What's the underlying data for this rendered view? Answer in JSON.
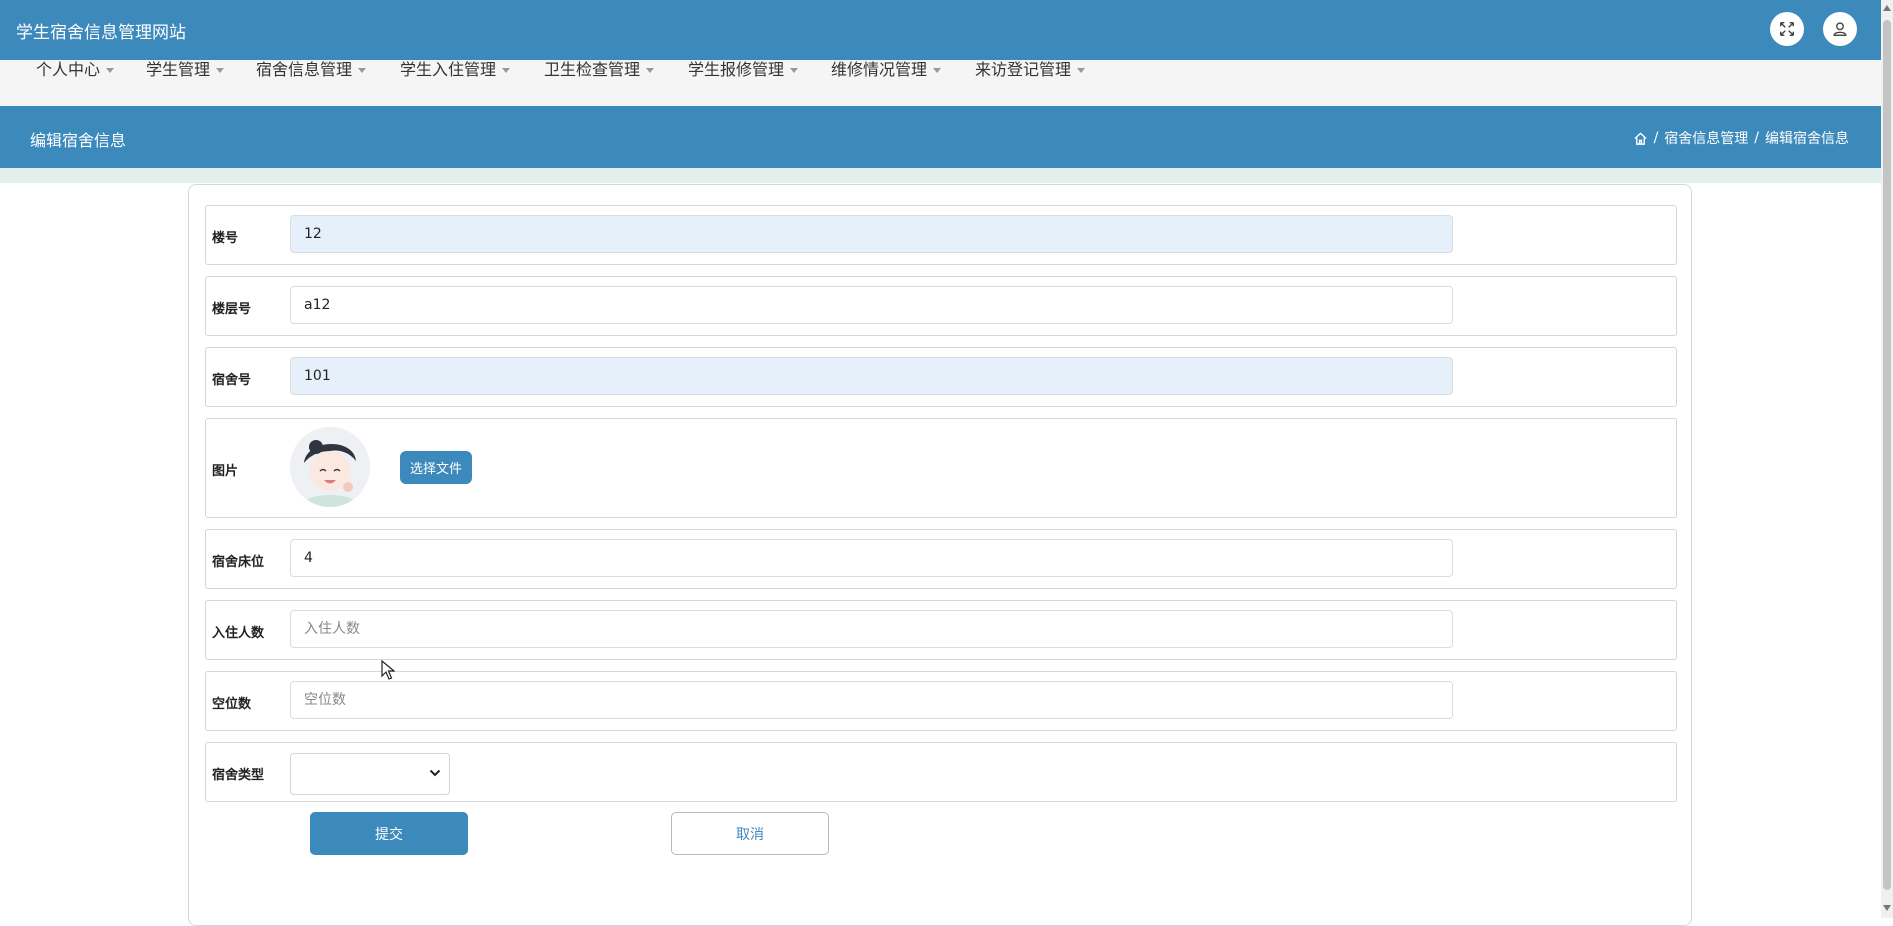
{
  "header": {
    "title": "学生宿舍信息管理网站"
  },
  "nav": {
    "items": [
      {
        "label": "个人中心"
      },
      {
        "label": "学生管理"
      },
      {
        "label": "宿舍信息管理"
      },
      {
        "label": "学生入住管理"
      },
      {
        "label": "卫生检查管理"
      },
      {
        "label": "学生报修管理"
      },
      {
        "label": "维修情况管理"
      },
      {
        "label": "来访登记管理"
      }
    ]
  },
  "page": {
    "title": "编辑宿舍信息",
    "breadcrumb": {
      "separator": "/",
      "section": "宿舍信息管理",
      "current": "编辑宿舍信息"
    }
  },
  "form": {
    "building": {
      "label": "楼号",
      "value": "12"
    },
    "floor": {
      "label": "楼层号",
      "value": "a12"
    },
    "dorm_no": {
      "label": "宿舍号",
      "value": "101"
    },
    "image": {
      "label": "图片",
      "button": "选择文件"
    },
    "beds": {
      "label": "宿舍床位",
      "value": "4"
    },
    "occupants": {
      "label": "入住人数",
      "placeholder": "入住人数"
    },
    "vacancies": {
      "label": "空位数",
      "placeholder": "空位数"
    },
    "dorm_type": {
      "label": "宿舍类型",
      "selected": ""
    },
    "submit_label": "提交",
    "cancel_label": "取消"
  },
  "colors": {
    "primary": "#3c89bc",
    "nav_bg": "#f5f5f5",
    "strip": "#e3efec"
  }
}
